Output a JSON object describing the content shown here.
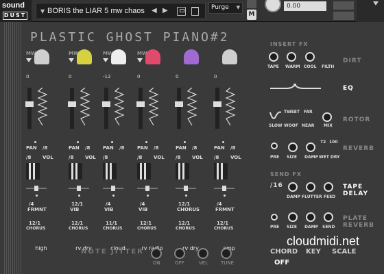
{
  "logo": {
    "line1": "sound",
    "line2": "DUST"
  },
  "preset": {
    "name": "BORIS the LIAR 5 mw chaos"
  },
  "purge": {
    "label": "Purge"
  },
  "m_button": "M",
  "tune_value": "0.00",
  "title": "PLASTIC GHOST PIANO#2",
  "channels": [
    {
      "mw": "MW",
      "top_val": "0",
      "pan_a": "PAN",
      "pan_b": "/8",
      "vol_a": "/8",
      "vol_b": "VOL",
      "frmnt_a": "/4",
      "frmnt_b": "FRMNT",
      "chorus_a": "12/1",
      "chorus_b": "CHORUS",
      "name": "high"
    },
    {
      "mw": "MW",
      "top_val": "0",
      "pan_a": "PAN",
      "pan_b": "/8",
      "vol_a": "/8",
      "vol_b": "VOL",
      "frmnt_a": "12/1",
      "frmnt_b": "VIB",
      "chorus_a": "12/1",
      "chorus_b": "CHORUS",
      "name": "rv dry"
    },
    {
      "mw": "MW",
      "top_val": "-12",
      "pan_a": "PAN",
      "pan_b": "/8",
      "vol_a": "/8",
      "vol_b": "",
      "frmnt_a": "/4",
      "frmnt_b": "VIB",
      "chorus_a": "11/1",
      "chorus_b": "CHORUS",
      "name": "cloud"
    },
    {
      "mw": "MW",
      "top_val": "0",
      "pan_a": "PAN",
      "pan_b": "/8",
      "vol_a": "/8",
      "vol_b": "VOL",
      "frmnt_a": "/4",
      "frmnt_b": "VIB",
      "chorus_a": "12/1",
      "chorus_b": "CHORUS",
      "name": "rv radio"
    },
    {
      "mw": "",
      "top_val": "0",
      "pan_a": "PAN",
      "pan_b": "/8",
      "vol_a": "/8",
      "vol_b": "VOL",
      "frmnt_a": "12/1",
      "frmnt_b": "CHORUS",
      "chorus_a": "12/1",
      "chorus_b": "CHORUS",
      "name": "rv dry"
    },
    {
      "mw": "",
      "top_val": "0",
      "pan_a": "PAN",
      "pan_b": "/8",
      "vol_a": "/8",
      "vol_b": "VOL",
      "frmnt_a": "/4",
      "frmnt_b": "FRMNT",
      "chorus_a": "12/1",
      "chorus_b": "CHORUS",
      "name": "amp"
    }
  ],
  "note_jitter": {
    "label": "NOTE JITTER",
    "on": "ON",
    "off": "OFF",
    "vel": "VEL",
    "tune": "TUNE"
  },
  "insert_fx": {
    "title": "INSERT FX",
    "knobs": [
      "TAPE",
      "WARM",
      "COOL",
      "FILTH"
    ],
    "dirt": "DIRT",
    "eq": "EQ",
    "rotor_labels": {
      "tweet": "TWEET",
      "far": "FAR",
      "slow": "SLOW",
      "woof": "WOOF",
      "near": "NEAR",
      "mix": "MIX"
    },
    "rotor": "ROTOR",
    "reverb_labels": {
      "pre": "PRE",
      "size": "SIZE",
      "damp": "DAMP",
      "wet": "WET DRY",
      "v72": "72",
      "v100": "100"
    },
    "reverb": "REVERB"
  },
  "send_fx": {
    "title": "SEND FX",
    "value": "/16",
    "knobs": [
      "DAMP",
      "FLUTTER",
      "FEED"
    ],
    "tape_delay_1": "TAPE",
    "tape_delay_2": "DELAY",
    "plate_knobs": [
      "PRE",
      "SIZE",
      "DAMP",
      "SEND"
    ],
    "plate_1": "PLATE",
    "plate_2": "REVERB"
  },
  "bottom": {
    "chord": "CHORD",
    "chord_val": "OFF",
    "key": "KEY",
    "scale": "SCALE",
    "watermark": "cloudmidi.net"
  },
  "colors": {
    "bg": "#3a3a3a",
    "panel": "#333333",
    "ghost_yellow": "#d7d040",
    "ghost_pink": "#e04a6b",
    "ghost_white": "#dddddd"
  }
}
